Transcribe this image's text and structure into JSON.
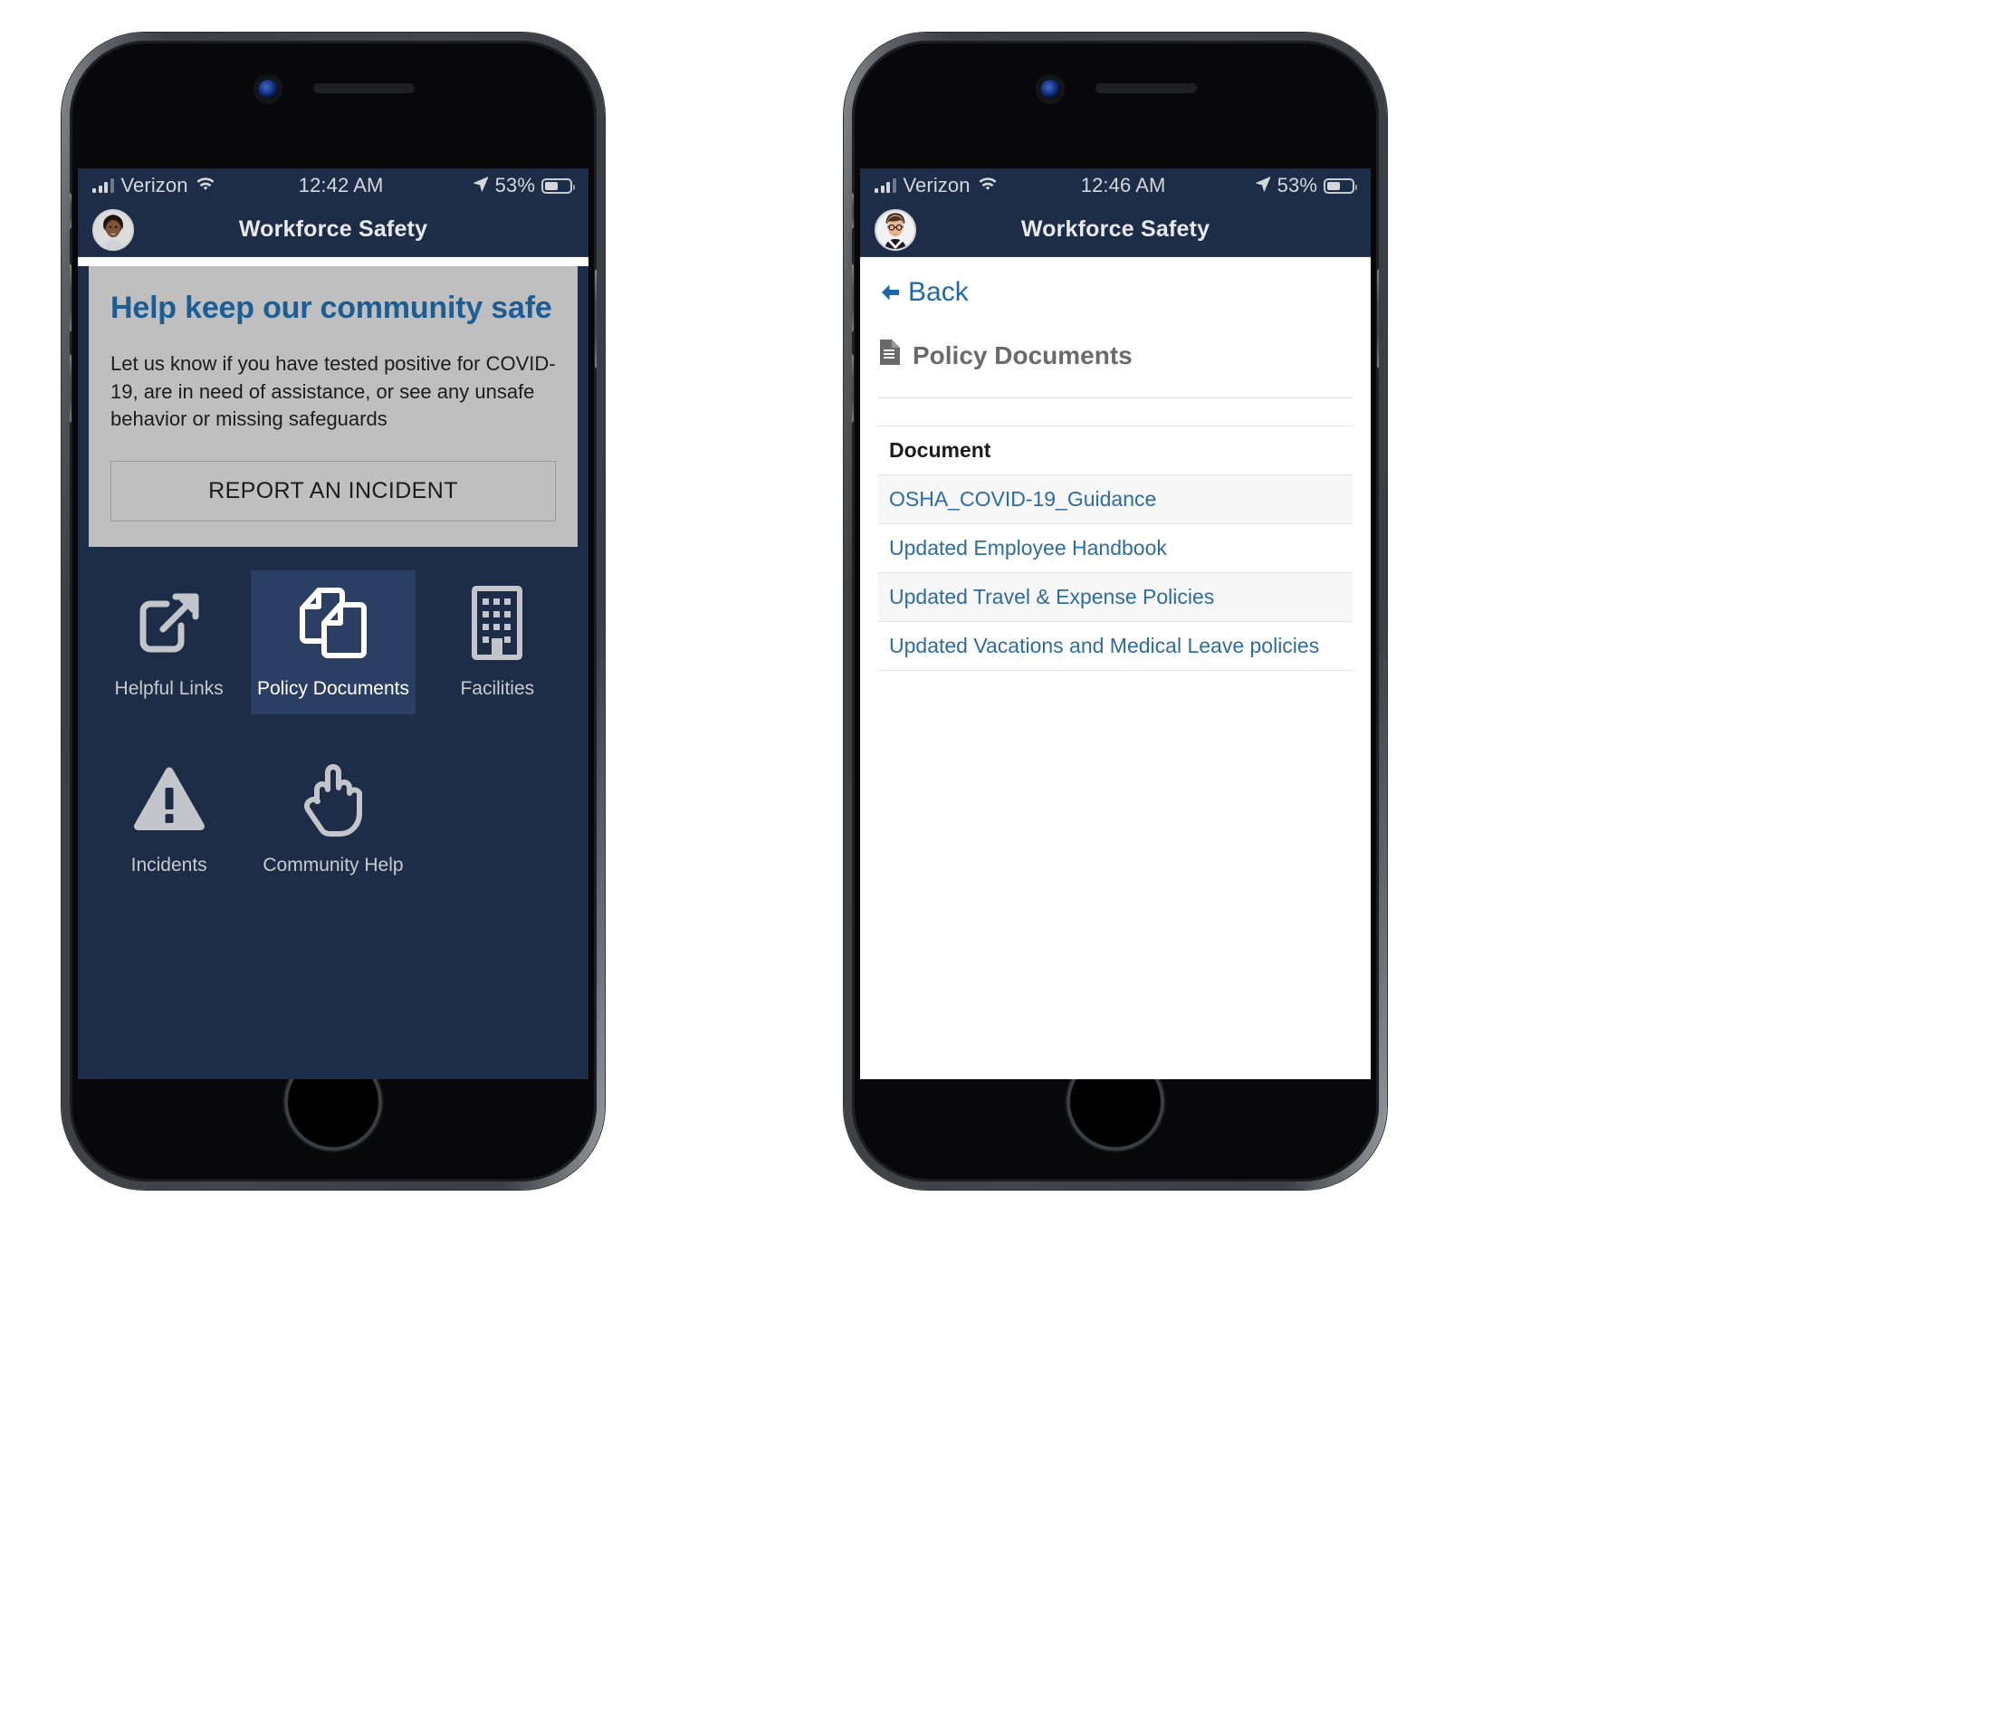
{
  "theme": {
    "navy": "#1d2d48",
    "tile_active": "#2a3f63",
    "card_gray": "#bfbfbf",
    "heading_blue": "#1b5e96",
    "link_blue": "#2b6ca3",
    "arrow_green": "#72bf24"
  },
  "phone1": {
    "status": {
      "carrier": "Verizon",
      "time": "12:42 AM",
      "battery_percent": "53%",
      "signal_icon": "signal-bars-icon",
      "wifi_icon": "wifi-icon",
      "location_icon": "location-arrow-icon",
      "battery_icon": "battery-icon"
    },
    "nav": {
      "title": "Workforce Safety",
      "avatar": "user-avatar"
    },
    "card": {
      "heading": "Help keep our community safe",
      "body": "Let us know if you have tested positive for COVID-19, are in need of assistance, or see any unsafe behavior or missing safeguards",
      "button_label": "REPORT AN INCIDENT"
    },
    "tiles": [
      {
        "label": "Helpful Links",
        "icon": "external-link-icon",
        "active": false
      },
      {
        "label": "Policy Documents",
        "icon": "documents-icon",
        "active": true
      },
      {
        "label": "Facilities",
        "icon": "building-icon",
        "active": false
      },
      {
        "label": "Incidents",
        "icon": "warning-triangle-icon",
        "active": false
      },
      {
        "label": "Community Help",
        "icon": "raised-hand-icon",
        "active": false
      }
    ]
  },
  "phone2": {
    "status": {
      "carrier": "Verizon",
      "time": "12:46 AM",
      "battery_percent": "53%",
      "signal_icon": "signal-bars-icon",
      "wifi_icon": "wifi-icon",
      "location_icon": "location-arrow-icon",
      "battery_icon": "battery-icon"
    },
    "nav": {
      "title": "Workforce Safety",
      "avatar": "user-avatar"
    },
    "back_label": "Back",
    "page_title": "Policy Documents",
    "page_title_icon": "document-icon",
    "table": {
      "column_header": "Document",
      "rows": [
        "OSHA_COVID-19_Guidance",
        "Updated Employee Handbook",
        "Updated Travel & Expense Policies",
        "Updated Vacations and Medical Leave policies"
      ]
    }
  },
  "arrow": {
    "icon": "right-arrow-icon",
    "color": "#72bf24"
  }
}
